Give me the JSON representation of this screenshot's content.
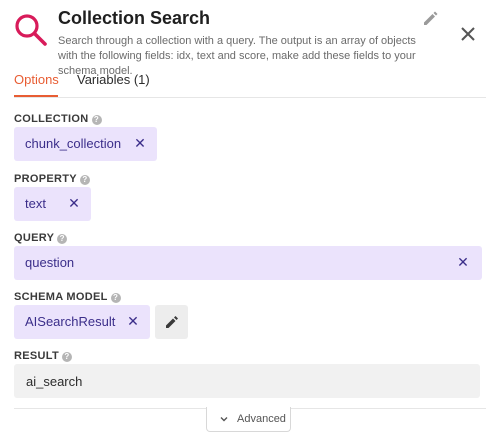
{
  "header": {
    "title": "Collection Search",
    "description": "Search through a collection with a query. The output is an array of objects with the following fields: idx, text and score, make add these fields to your schema model."
  },
  "tabs": [
    {
      "label": "Options",
      "active": true
    },
    {
      "label": "Variables (1)",
      "active": false
    }
  ],
  "fields": {
    "collection": {
      "label": "COLLECTION",
      "value": "chunk_collection"
    },
    "property": {
      "label": "PROPERTY",
      "value": "text"
    },
    "query": {
      "label": "QUERY",
      "value": "question"
    },
    "schema_model": {
      "label": "SCHEMA MODEL",
      "value": "AISearchResult"
    },
    "result": {
      "label": "RESULT",
      "value": "ai_search"
    }
  },
  "advanced_label": "Advanced",
  "icons": {
    "search": "search-icon",
    "edit": "pencil-icon",
    "close": "close-icon",
    "help": "help-icon",
    "remove": "remove-icon",
    "chevron": "chevron-down-icon"
  },
  "colors": {
    "brand": "#d81b5a",
    "accent": "#e85d33",
    "chip_bg": "#ebe3fc",
    "chip_text": "#3b2e8a"
  }
}
